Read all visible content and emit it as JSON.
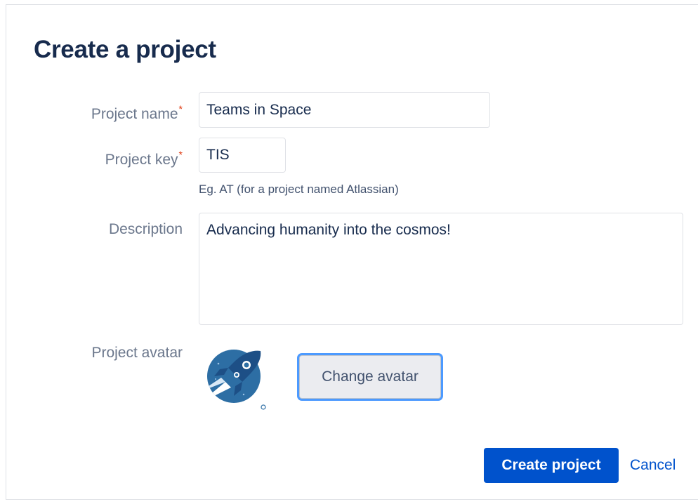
{
  "dialog": {
    "title": "Create a project"
  },
  "form": {
    "project_name": {
      "label": "Project name",
      "required_marker": "*",
      "value": "Teams in Space"
    },
    "project_key": {
      "label": "Project key",
      "required_marker": "*",
      "value": "TIS",
      "hint": "Eg. AT (for a project named Atlassian)"
    },
    "description": {
      "label": "Description",
      "value": "Advancing humanity into the cosmos!"
    },
    "avatar": {
      "label": "Project avatar",
      "icon": "rocket-avatar-icon",
      "change_label": "Change avatar"
    }
  },
  "actions": {
    "create_label": "Create project",
    "cancel_label": "Cancel"
  },
  "colors": {
    "primary": "#0052cc",
    "title": "#172b4d",
    "label": "#6b778c",
    "required": "#de350b",
    "focus_ring": "#4c9aff",
    "avatar_bg": "#2d6ea4"
  }
}
